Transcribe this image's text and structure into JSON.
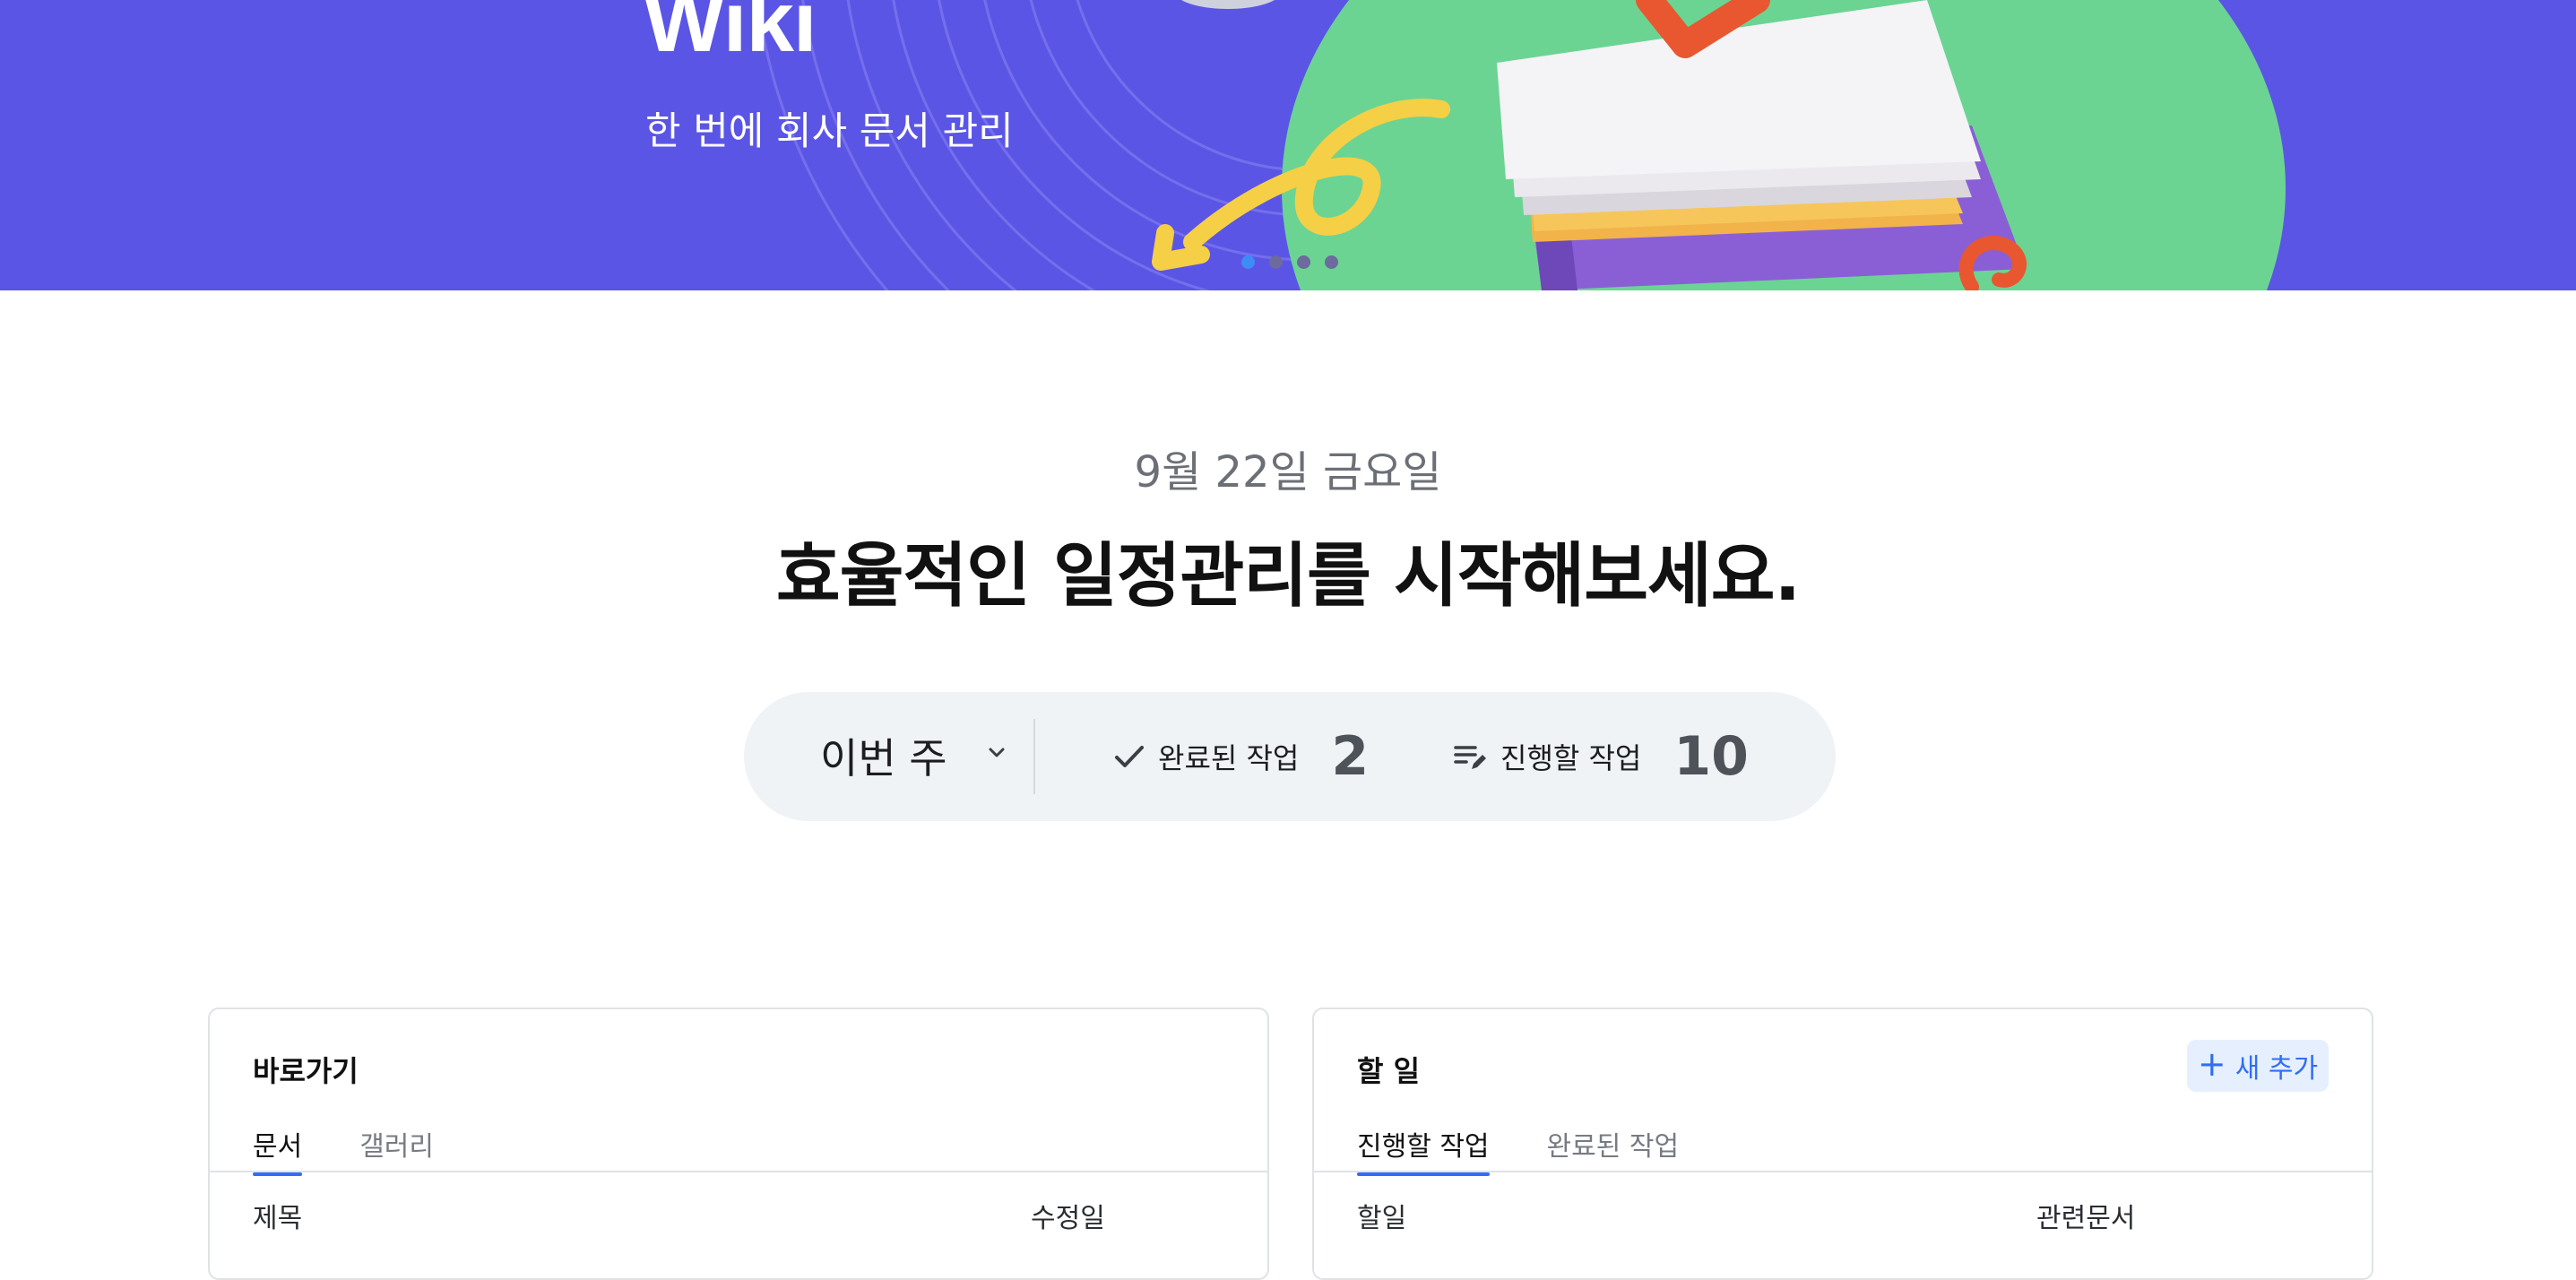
{
  "hero": {
    "title": "Wiki",
    "subtitle": "한 번에 회사 문서 관리",
    "slides": 4,
    "active_slide": 1
  },
  "date_line": "9월 22일 금요일",
  "headline": "효율적인 일정관리를 시작해보세요.",
  "stats": {
    "period": "이번 주",
    "completed_label": "완료된 작업",
    "completed_count": "2",
    "todo_label": "진행할 작업",
    "todo_count": "10"
  },
  "shortcuts": {
    "title": "바로가기",
    "tabs": [
      "문서",
      "갤러리"
    ],
    "active_tab": 0,
    "columns": [
      "제목",
      "수정일"
    ]
  },
  "todos": {
    "title": "할 일",
    "add_label": "새 추가",
    "tabs": [
      "진행할 작업",
      "완료된 작업"
    ],
    "active_tab": 0,
    "columns": [
      "할일",
      "관련문서"
    ]
  },
  "colors": {
    "hero_bg": "#5b55e6",
    "accent": "#2f6ef5",
    "pill_bg": "#f0f3f6"
  },
  "icons": [
    "checkmark-icon",
    "edit-list-icon",
    "chevron-down-icon",
    "plus-icon"
  ]
}
